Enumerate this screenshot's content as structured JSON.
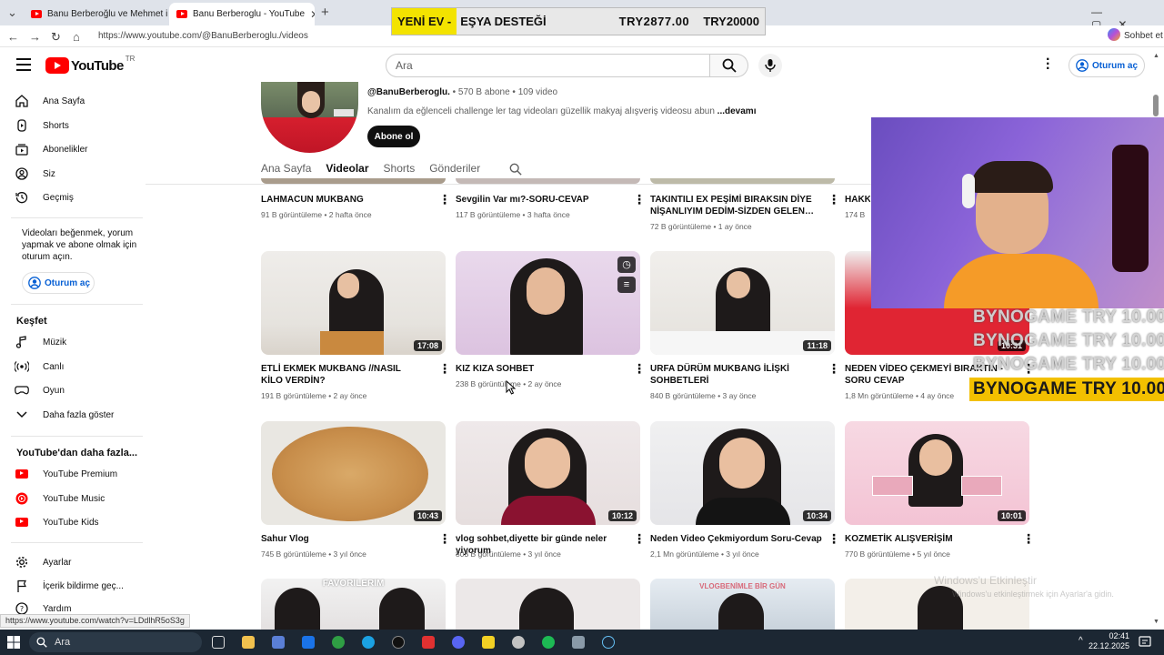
{
  "browser": {
    "tabs": [
      {
        "title": "Banu Berberoğlu ve Mehmet ile Bi…",
        "active": false
      },
      {
        "title": "Banu Berberoglu - YouTube",
        "active": true
      }
    ],
    "url": "https://www.youtube.com/@BanuBerberoglu./videos",
    "copilot_label": "Sohbet et"
  },
  "overlay": {
    "banner_new": "YENİ EV -",
    "banner_item": "EŞYA DESTEĞİ",
    "banner_current": "TRY2877.00",
    "banner_goal": "TRY20000",
    "donations": [
      "BYNOGAME  TRY 10.00",
      "BYNOGAME  TRY 10.00",
      "BYNOGAME  TRY 10.00",
      "BYNOGAME  TRY 10.00"
    ]
  },
  "header": {
    "logo_word": "YouTube",
    "region": "TR",
    "search_placeholder": "Ara",
    "signin_label": "Oturum aç"
  },
  "sidebar": {
    "main": [
      {
        "label": "Ana Sayfa",
        "icon": "home-icon"
      },
      {
        "label": "Shorts",
        "icon": "shorts-icon"
      },
      {
        "label": "Abonelikler",
        "icon": "subscriptions-icon"
      },
      {
        "label": "Siz",
        "icon": "you-icon"
      },
      {
        "label": "Geçmiş",
        "icon": "history-icon"
      }
    ],
    "signin_note": "Videoları beğenmek, yorum yapmak ve abone olmak için oturum açın.",
    "signin_label": "Oturum aç",
    "explore_heading": "Keşfet",
    "explore": [
      {
        "label": "Müzik",
        "icon": "music-icon"
      },
      {
        "label": "Canlı",
        "icon": "live-icon"
      },
      {
        "label": "Oyun",
        "icon": "gaming-icon"
      },
      {
        "label": "Daha fazla göster",
        "icon": "chevron-down-icon"
      }
    ],
    "more_heading": "YouTube'dan daha fazla...",
    "more": [
      {
        "label": "YouTube Premium"
      },
      {
        "label": "YouTube Music"
      },
      {
        "label": "YouTube Kids"
      }
    ],
    "settings": [
      {
        "label": "Ayarlar",
        "icon": "gear-icon"
      },
      {
        "label": "İçerik bildirme geç...",
        "icon": "flag-icon"
      },
      {
        "label": "Yardım",
        "icon": "help-icon"
      }
    ]
  },
  "channel": {
    "handle": "@BanuBerberoglu.",
    "meta": " • 570 B abone • 109 video",
    "description": "Kanalım da eğlenceli challenge ler tag videoları güzellik makyaj alışveriş videosu  abun",
    "more_link": "...devamı",
    "subscribe_label": "Abone ol",
    "tabs": [
      "Ana Sayfa",
      "Videolar",
      "Shorts",
      "Gönderiler"
    ],
    "active_tab": "Videolar"
  },
  "videos_row1": [
    {
      "title": "LAHMACUN MUKBANG",
      "meta": "91 B görüntüleme • 2 hafta önce"
    },
    {
      "title": "Sevgilin Var mı?-SORU-CEVAP",
      "meta": "117 B görüntüleme • 3 hafta önce"
    },
    {
      "title": "TAKINTILI EX PEŞİMİ BIRAKSIN DİYE NİŞANLIYIM DEDİM-SİZDEN GELEN…",
      "meta": "72 B görüntüleme • 1 ay önce"
    },
    {
      "title": "HAKKI",
      "meta": "174 B"
    }
  ],
  "videos_row2": [
    {
      "title": "ETLİ EKMEK MUKBANG //NASIL KİLO VERDİN?",
      "meta": "191 B görüntüleme • 2 ay önce",
      "duration": "17:08"
    },
    {
      "title": "KIZ KIZA SOHBET",
      "meta": "238 B görüntüleme • 2 ay önce",
      "duration": ""
    },
    {
      "title": "URFA DÜRÜM MUKBANG İLİŞKİ SOHBETLERİ",
      "meta": "840 B görüntüleme • 3 ay önce",
      "duration": "11:18"
    },
    {
      "title": "NEDEN VİDEO ÇEKMEYİ BIRAKTIN - SORU CEVAP",
      "meta": "1,8 Mn görüntüleme • 4 ay önce",
      "duration": "10:31"
    }
  ],
  "videos_row3": [
    {
      "title": "Sahur Vlog",
      "meta": "745 B görüntüleme • 3 yıl önce",
      "duration": "10:43"
    },
    {
      "title": "vlog sohbet,diyette bir günde neler yiyorum",
      "meta": "803 B görüntüleme • 3 yıl önce",
      "duration": "10:12"
    },
    {
      "title": "Neden Video Çekmiyordum Soru-Cevap",
      "meta": "2,1 Mn görüntüleme • 3 yıl önce",
      "duration": "10:34"
    },
    {
      "title": "KOZMETİK ALIŞVERİŞİM",
      "meta": "770 B görüntüleme • 5 yıl önce",
      "duration": "10:01"
    }
  ],
  "row4_labels": [
    "FAVORİLERİM",
    "VLOGBENİMLE BİR GÜN"
  ],
  "status_url": "https://www.youtube.com/watch?v=LDdlhR5oS3g",
  "watermark": {
    "line1": "Windows'u Etkinleştir",
    "line2": "Windows'u etkinleştirmek için Ayarlar'a gidin."
  },
  "taskbar": {
    "search": "Ara",
    "time": "02:41",
    "date": "22.12.2025"
  }
}
